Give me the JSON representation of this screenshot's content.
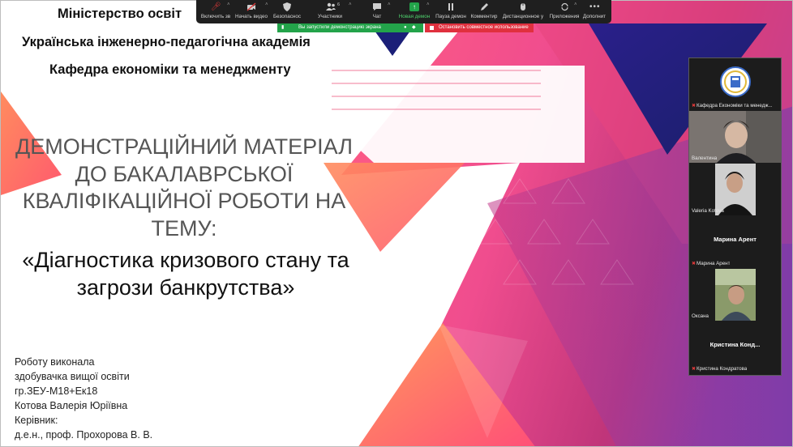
{
  "slide": {
    "header": {
      "line1": "Міністерство освіт",
      "line2": "Українська інженерно-педагогічна академія",
      "line3": "Кафедра економіки та менеджменту"
    },
    "title_lines": [
      "ДЕМОНСТРАЦІЙНИЙ МАТЕРІАЛ",
      "ДО БАКАЛАВРСЬКОЇ",
      "КВАЛІФІКАЦІЙНОЇ РОБОТИ НА",
      "ТЕМУ:"
    ],
    "topic_lines": [
      "«Діагностика кризового стану та",
      "загрози банкрутства»"
    ],
    "author_lines": [
      "Роботу виконала",
      "здобувачка вищої освіти",
      "гр.ЗЕУ-М18+Ек18",
      "Котова Валерія Юріївна",
      "Керівник:",
      "д.е.н., проф. Прохорова В. В."
    ]
  },
  "toolbar": {
    "buttons": [
      {
        "id": "audio",
        "label": "Включить зв",
        "icon": "microphone-muted-icon"
      },
      {
        "id": "video",
        "label": "Начать видео",
        "icon": "camera-off-icon"
      },
      {
        "id": "security",
        "label": "Безопаснос",
        "icon": "shield-icon"
      },
      {
        "id": "participants",
        "label": "Участники",
        "icon": "people-icon",
        "count": "6"
      },
      {
        "id": "chat",
        "label": "Чат",
        "icon": "chat-icon"
      },
      {
        "id": "new_share",
        "label": "Новая демон",
        "icon": "share-up-arrow-icon"
      },
      {
        "id": "pause_share",
        "label": "Пауза демон",
        "icon": "pause-icon"
      },
      {
        "id": "annotate",
        "label": "Комментир",
        "icon": "pencil-icon"
      },
      {
        "id": "remote",
        "label": "Дистанционное у",
        "icon": "mouse-icon"
      },
      {
        "id": "apps",
        "label": "Приложения",
        "icon": "apps-icon"
      },
      {
        "id": "more",
        "label": "Дополнит",
        "icon": "more-dots-icon"
      }
    ],
    "share_status": "Вы запустили демонстрацию экрана",
    "stop_share": "Остановить совместное использование"
  },
  "panel": {
    "tiles": [
      {
        "name": "Кафедра Економіки та менедж...",
        "muted": true,
        "kind": "logo"
      },
      {
        "name": "Валентина",
        "muted": false,
        "kind": "video"
      },
      {
        "name": "Valeria Kotova",
        "muted": false,
        "kind": "video"
      },
      {
        "name": "Марина Арент",
        "muted": true,
        "kind": "name",
        "center": "Марина Арент"
      },
      {
        "name": "Оксана",
        "muted": false,
        "kind": "video"
      },
      {
        "name": "Кристина Кондратова",
        "muted": true,
        "kind": "name",
        "center": "Кристина  Конд..."
      }
    ]
  },
  "colors": {
    "pink": "#ff4f8b",
    "magenta": "#c0357a",
    "purple": "#8b3fa8",
    "navy": "#1b1f78",
    "coral": "#ff7a5a",
    "toolbar_bg": "#1f1f1f",
    "share_green": "#23a34a",
    "stop_red": "#e0303e"
  }
}
